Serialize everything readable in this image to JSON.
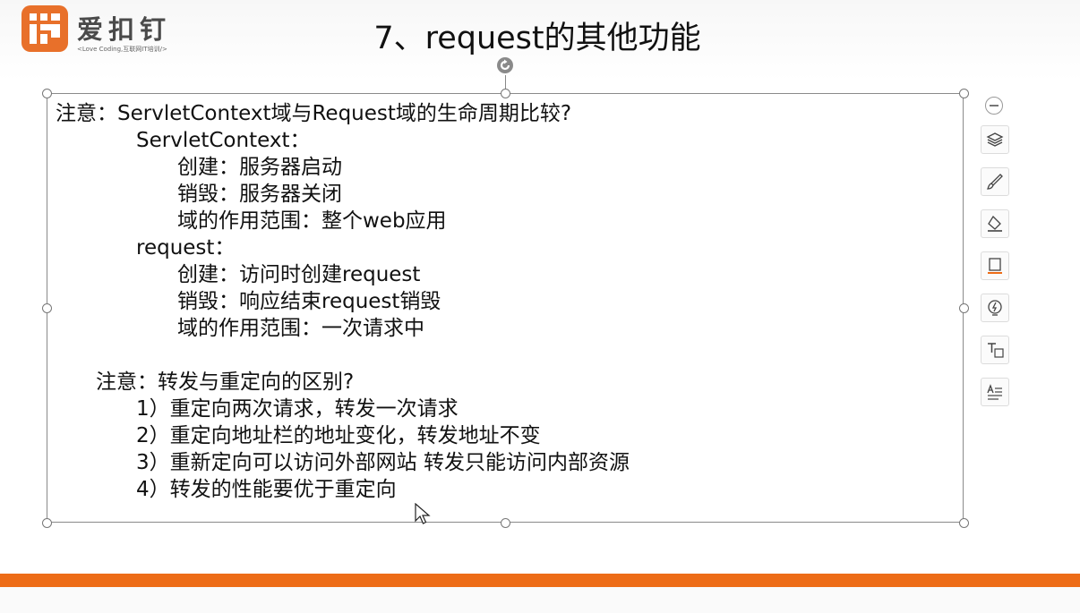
{
  "logo": {
    "brand": "爱扣钉",
    "tagline": "<Love Coding,互联网IT培训/>"
  },
  "slide": {
    "title": "7、request的其他功能",
    "lines": [
      "注意：ServletContext域与Request域的生命周期比较?",
      "ServletContext：",
      "创建：服务器启动",
      "销毁：服务器关闭",
      "域的作用范围：整个web应用",
      "request：",
      "创建：访问时创建request",
      "销毁：响应结束request销毁",
      "域的作用范围：一次请求中",
      "注意：转发与重定向的区别?",
      "1）重定向两次请求，转发一次请求",
      "2）重定向地址栏的地址变化，转发地址不变",
      "3）重新定向可以访问外部网站 转发只能访问内部资源",
      "4）转发的性能要优于重定向"
    ]
  },
  "toolbar": {
    "buttons": [
      "collapse-icon",
      "layers-icon",
      "brush-icon",
      "fill-icon",
      "outline-icon",
      "idea-icon",
      "text-box-icon",
      "text-effects-icon"
    ]
  },
  "colors": {
    "accent": "#ed6c17",
    "logo": "#e8702a"
  }
}
